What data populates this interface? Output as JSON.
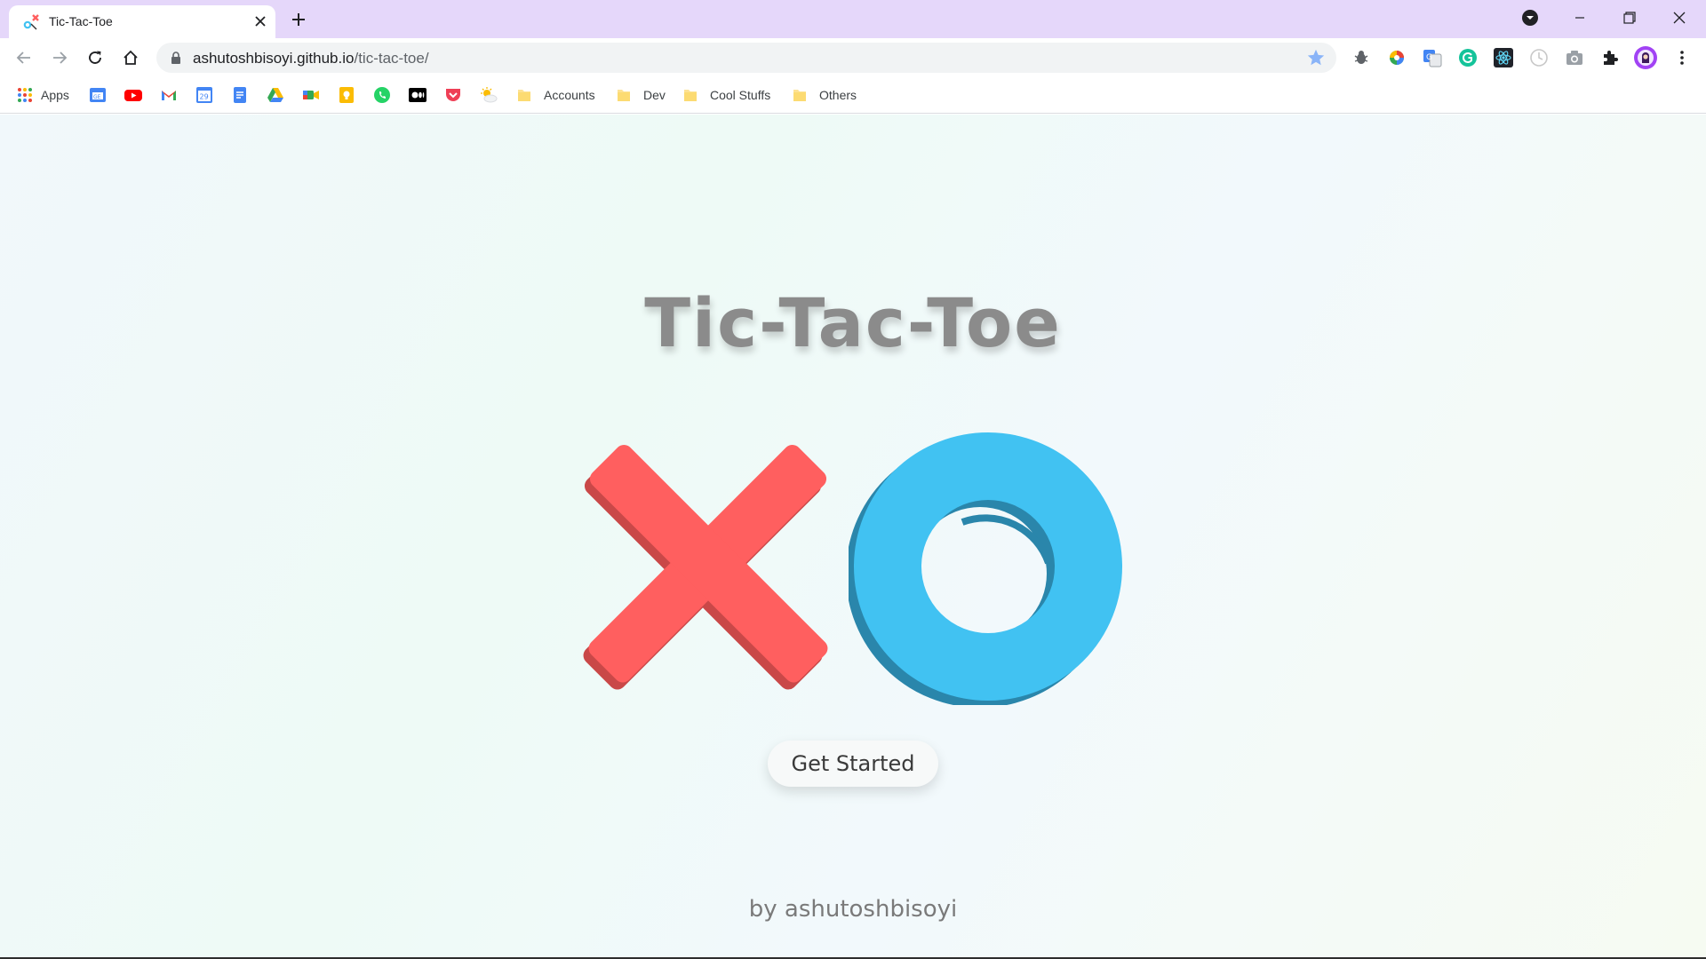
{
  "browser": {
    "tab": {
      "title": "Tic-Tac-Toe"
    },
    "address_bar": {
      "domain": "ashutoshbisoyi.github.io",
      "path": "/tic-tac-toe/"
    },
    "bookmarks": {
      "apps_label": "Apps",
      "folders": [
        "Accounts",
        "Dev",
        "Cool Stuffs",
        "Others"
      ],
      "calendar_day": "29"
    }
  },
  "page": {
    "title": "Tic-Tac-Toe",
    "start_button": "Get Started",
    "footer": "by ashutoshbisoyi"
  },
  "colors": {
    "x_mark": "#ff5f5f",
    "o_mark": "#41c2f2",
    "tab_strip": "#e5d7fa"
  }
}
